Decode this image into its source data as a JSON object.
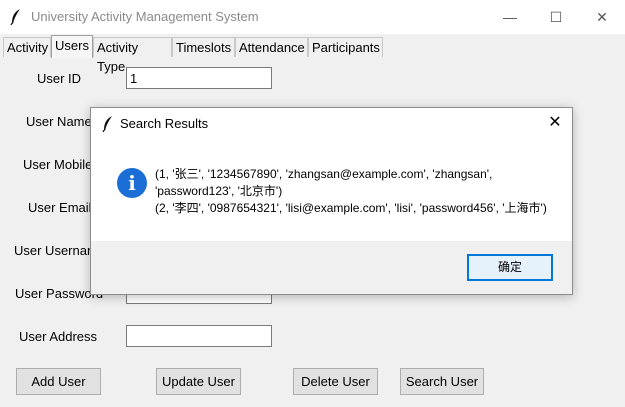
{
  "window": {
    "title": "University Activity Management System",
    "controls": {
      "minimize": "—",
      "maximize": "☐",
      "close": "✕"
    }
  },
  "tabs": [
    {
      "label": "Activity"
    },
    {
      "label": "Users",
      "active": true
    },
    {
      "label": "Activity Type"
    },
    {
      "label": "Timeslots"
    },
    {
      "label": "Attendance"
    },
    {
      "label": "Participants"
    }
  ],
  "form": {
    "user_id_label": "User ID",
    "user_id_value": "1",
    "user_name_label": "User Name",
    "user_mobile_label": "User Mobile",
    "user_email_label": "User Email",
    "user_username_label": "User Usernar",
    "user_password_label": "User Password",
    "user_address_label": "User Address"
  },
  "buttons": {
    "add": "Add User",
    "update": "Update User",
    "delete": "Delete User",
    "search": "Search User"
  },
  "dialog": {
    "title": "Search Results",
    "close": "✕",
    "icon": "info-icon",
    "message_line1": "(1, '张三', '1234567890', 'zhangsan@example.com', 'zhangsan',",
    "message_line2": "'password123', '北京市')",
    "message_line3": "(2, '李四', '0987654321', 'lisi@example.com', 'lisi', 'password456', '上海市')",
    "ok": "确定"
  },
  "colors": {
    "accent": "#0078d7",
    "info": "#1a6ed6"
  }
}
